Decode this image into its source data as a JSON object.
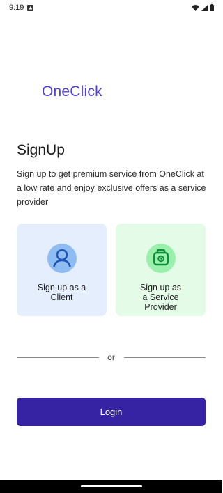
{
  "status_bar": {
    "time": "9:19",
    "icons": [
      "notification-icon",
      "wifi-icon",
      "signal-icon",
      "battery-icon"
    ]
  },
  "brand": "OneClick",
  "title": "SignUp",
  "description": "Sign up to get premium service from OneClick at a low rate and enjoy exclusive offers as a service provider",
  "cards": {
    "client": {
      "label": "Sign up as a\nClient",
      "icon": "user-icon",
      "background": "#e4eefc"
    },
    "provider": {
      "label": "Sign up as\na Service\nProvider",
      "icon": "briefcase-icon",
      "background": "#e3fbe7"
    }
  },
  "divider_text": "or",
  "login_label": "Login",
  "colors": {
    "brand": "#4f3fd6",
    "primary_button": "#3623a3"
  }
}
